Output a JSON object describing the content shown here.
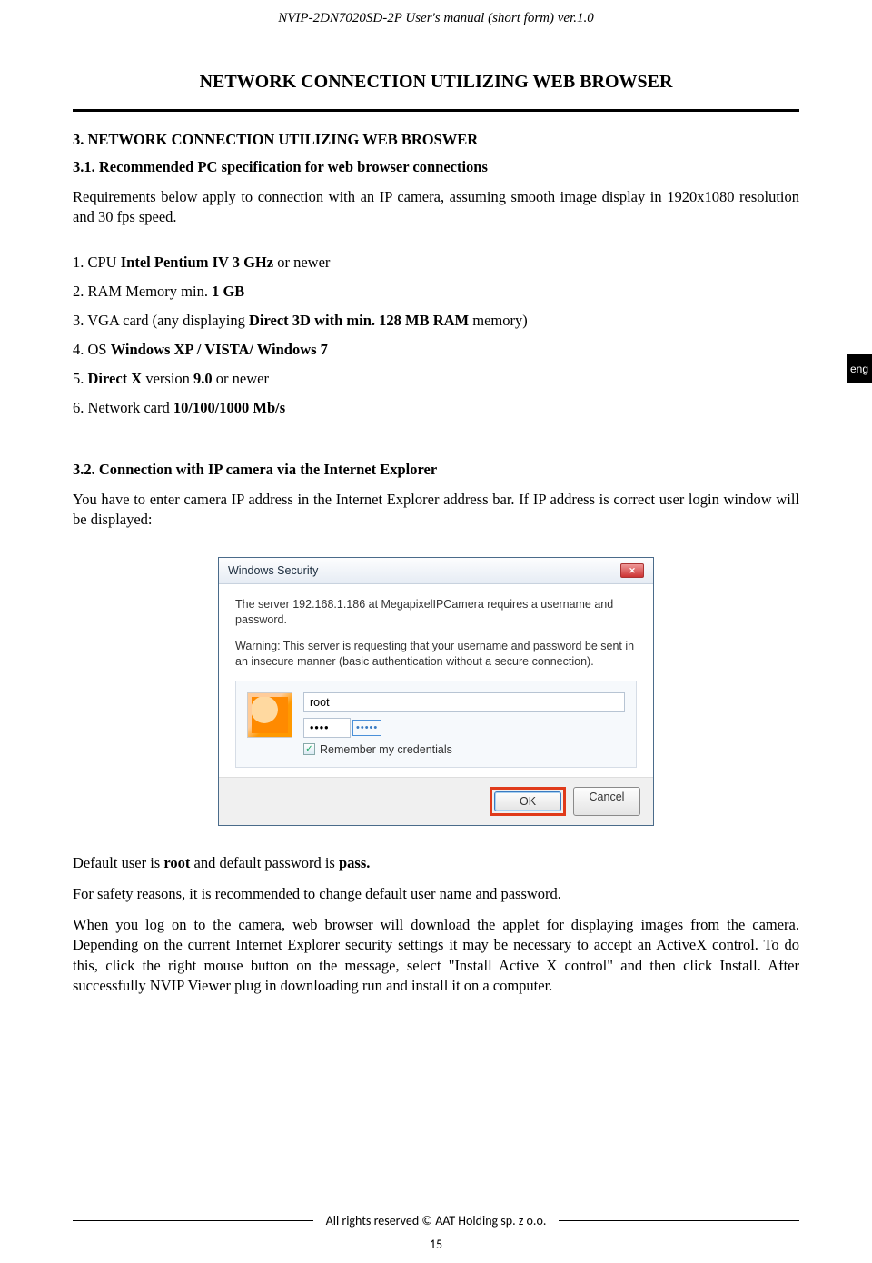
{
  "header": {
    "doc_title": "NVIP-2DN7020SD-2P User's manual (short form) ver.1.0"
  },
  "section_title": "NETWORK CONNECTION UTILIZING WEB BROWSER",
  "lang_tab": "eng",
  "h31": "3. NETWORK CONNECTION UTILIZING WEB BROSWER",
  "h31a": "3.1. Recommended PC specification for web browser connections",
  "p1": "Requirements below apply to connection with an IP camera, assuming smooth image display in 1920x1080 resolution and 30 fps speed.",
  "req": {
    "1": {
      "pre": "1. CPU ",
      "b": "Intel Pentium IV 3 GHz",
      "post": " or newer"
    },
    "2": {
      "pre": "2. RAM Memory min. ",
      "b": "1 GB",
      "post": ""
    },
    "3": {
      "pre": "3. VGA card (any displaying ",
      "b": "Direct 3D with min. 128 MB RAM",
      "post": " memory)"
    },
    "4": {
      "pre": "4. OS ",
      "b": "Windows XP / VISTA/ Windows 7",
      "post": ""
    },
    "5": {
      "pre": "5. ",
      "b": "Direct X",
      "post1": " version ",
      "b2": "9.0",
      "post2": " or newer"
    },
    "6": {
      "pre": "6. Network card ",
      "b": "10/100/1000 Mb/s",
      "post": ""
    }
  },
  "h32": "3.2. Connection with IP camera via the Internet Explorer",
  "p2": "You have to enter camera IP address in the Internet Explorer address bar. If IP address is correct user login window will be displayed:",
  "dialog": {
    "title": "Windows Security",
    "msg1": "The server 192.168.1.186 at MegapixelIPCamera requires a username and password.",
    "msg2": "Warning: This server is requesting that your username and password be sent in an insecure manner (basic authentication without a secure connection).",
    "user_value": "root",
    "pw_dots": "••••",
    "pw_blue": "•••••",
    "remember": "Remember my credentials",
    "ok": "OK",
    "cancel": "Cancel"
  },
  "p3a": "Default user is ",
  "p3b": "root",
  "p3c": " and default password is ",
  "p3d": "pass.",
  "p4": "For safety reasons, it is recommended to change default user name and password.",
  "p5": "When you log on to the camera, web browser will download the applet for displaying images from the camera. Depending on the current Internet Explorer security settings it may be necessary to accept an ActiveX control. To do this, click the right mouse button on the message, select \"Install Active X control\" and then click Install. After successfully NVIP Viewer plug in downloading run and install it on a computer.",
  "footer": "All rights reserved © AAT Holding sp. z o.o.",
  "page": "15"
}
